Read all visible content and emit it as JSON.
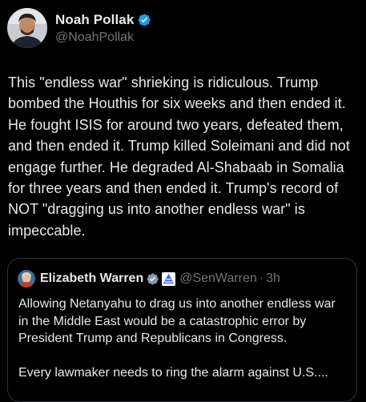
{
  "author": {
    "display_name": "Noah Pollak",
    "handle": "@NoahPollak",
    "avatar_icon": "person-avatar-icon",
    "verified_icon": "verified-badge-icon"
  },
  "tweet": {
    "text": "This \"endless war\" shrieking is ridiculous. Trump bombed the Houthis for six weeks and then ended it. He fought ISIS for around two years, defeated them, and then ended it. Trump killed Soleimani and did not engage further. He degraded Al-Shabaab in Somalia for three years and then ended it. Trump's record of NOT \"dragging us into another endless war\" is impeccable."
  },
  "quoted_tweet": {
    "display_name": "Elizabeth Warren",
    "handle": "@SenWarren",
    "separator": "·",
    "time": "3h",
    "avatar_icon": "person-avatar-icon",
    "verified_icon": "verified-badge-icon",
    "gov_icon": "government-badge-icon",
    "paragraphs": [
      "Allowing Netanyahu to drag us into another endless war in the Middle East would be a catastrophic error by President Trump and Republicans in Congress.",
      "Every lawmaker needs to ring the alarm against U.S...."
    ]
  },
  "colors": {
    "background": "#000000",
    "text_primary": "#e7e9ea",
    "text_secondary": "#71767b",
    "verified_blue": "#1d9bf0",
    "border": "#2f3336"
  }
}
